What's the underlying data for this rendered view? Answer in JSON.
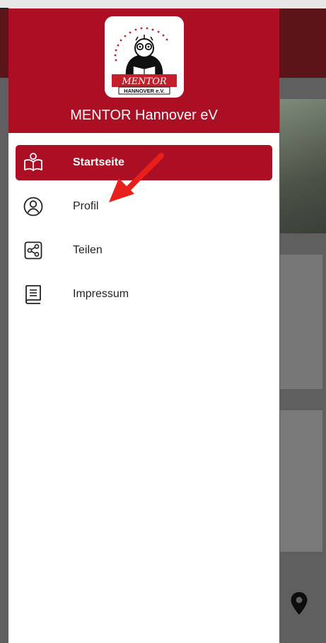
{
  "drawer": {
    "app_name": "MENTOR Hannover eV",
    "logo": {
      "tagline": "Die Leselernhelfer",
      "brand": "MENTOR",
      "sub": "HANNOVER e.V."
    },
    "menu": [
      {
        "label": "Startseite",
        "icon": "book-reader-icon",
        "active": true
      },
      {
        "label": "Profil",
        "icon": "profile-icon",
        "active": false
      },
      {
        "label": "Teilen",
        "icon": "share-icon",
        "active": false
      },
      {
        "label": "Impressum",
        "icon": "document-icon",
        "active": false
      }
    ]
  },
  "colors": {
    "brand_red": "#ac0f23",
    "annotation_arrow": "#e8201c"
  }
}
